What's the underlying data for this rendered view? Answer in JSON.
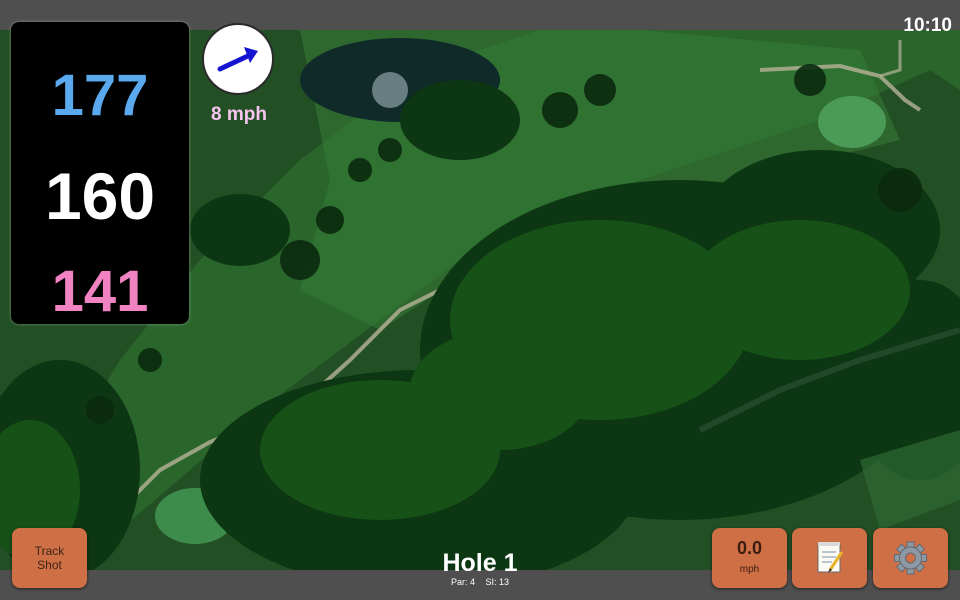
{
  "status_bar": {
    "time": "10:10"
  },
  "distances": {
    "back": "177",
    "middle": "160",
    "front": "141"
  },
  "wind": {
    "speed": "8 mph",
    "direction_icon": "wind-arrow-icon"
  },
  "buttons": {
    "track_shot": "Track\nShot",
    "speed_value": "0.0",
    "speed_unit": "mph",
    "notes_icon": "notepad-icon",
    "settings_icon": "gear-icon"
  },
  "hole": {
    "title": "Hole 1",
    "par": "Par: 4",
    "si": "SI: 13"
  },
  "colors": {
    "back": "#5aa9ef",
    "middle": "#ffffff",
    "front": "#f283c2",
    "button": "#cf6f45",
    "wind_speed": "#f7c4f0"
  }
}
